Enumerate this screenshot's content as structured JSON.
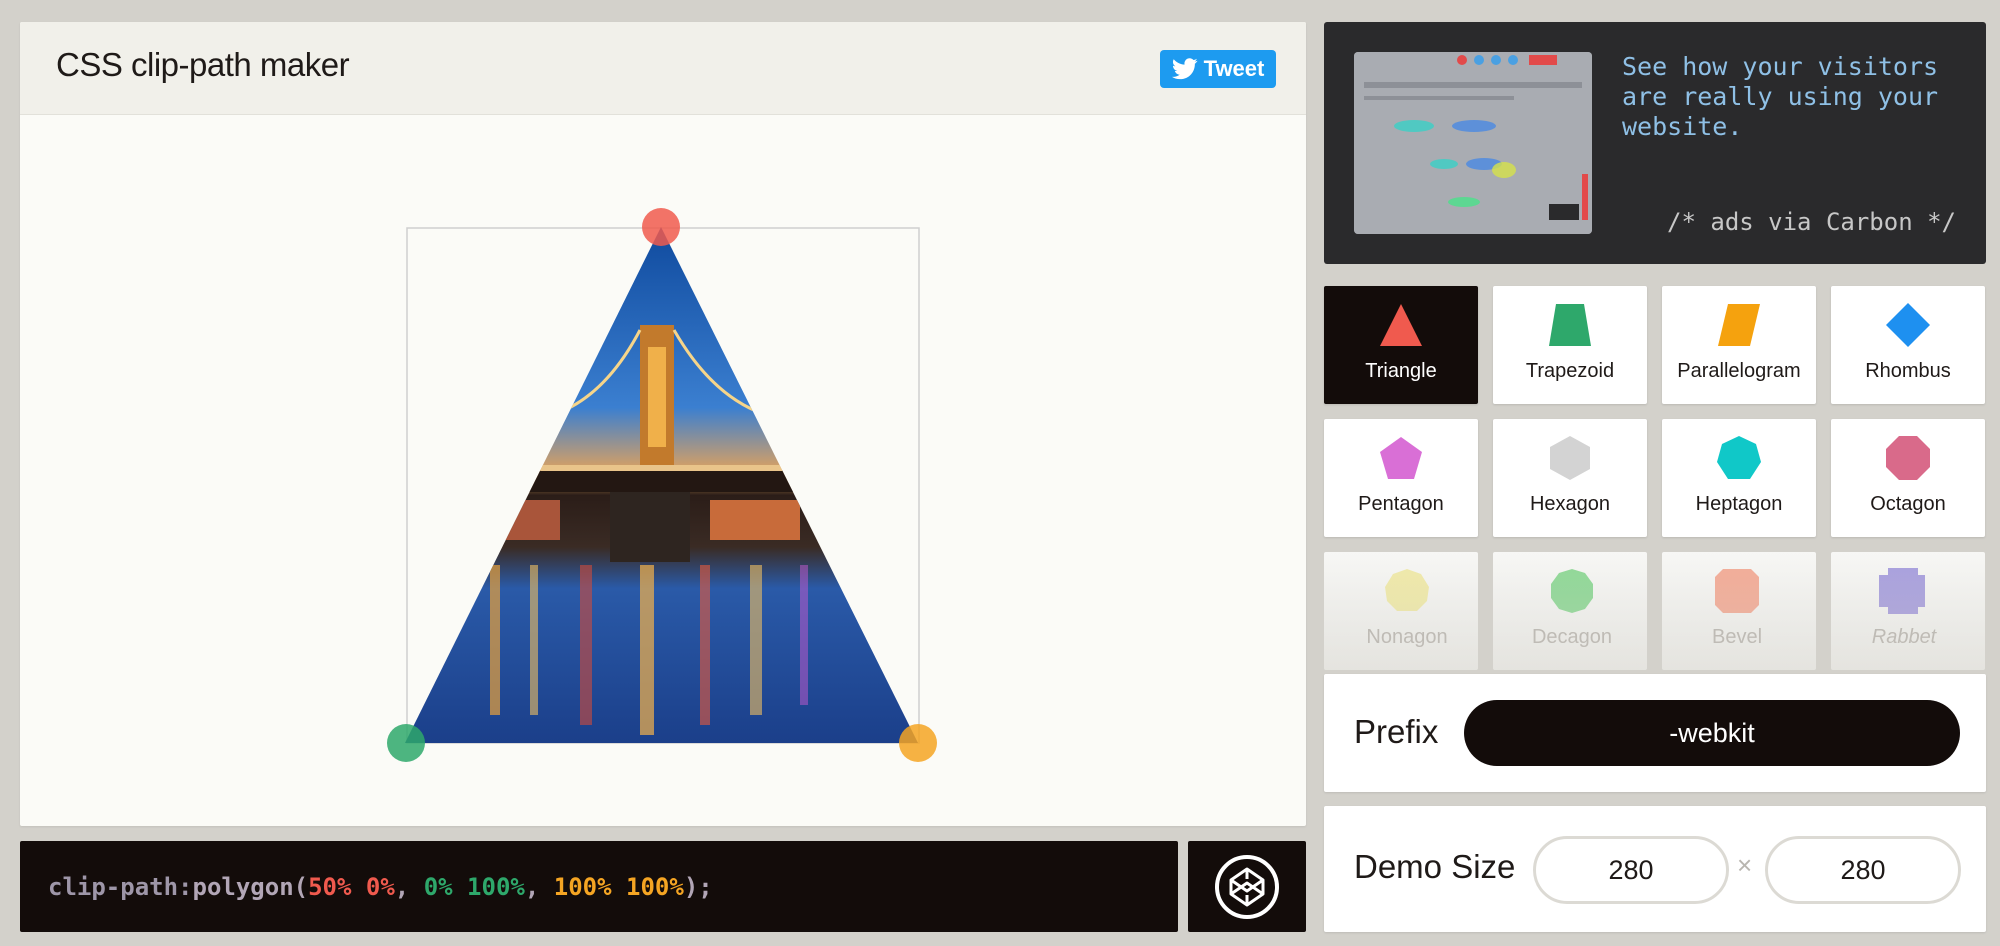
{
  "header": {
    "title": "CSS clip-path maker",
    "tweet_label": "Tweet"
  },
  "code": {
    "property": "clip-path:",
    "fn_open": "polygon(",
    "p1": "50% 0%",
    "p2": "0% 100%",
    "p3": "100% 100%",
    "fn_close": ");",
    "sep": ", "
  },
  "ad": {
    "text": "See how your visitors are really using your website.",
    "via": "/* ads via Carbon */"
  },
  "shapes": [
    {
      "label": "Triangle",
      "color": "#f05a4e",
      "active": true
    },
    {
      "label": "Trapezoid",
      "color": "#2ea86b"
    },
    {
      "label": "Parallelogram",
      "color": "#f5a20e"
    },
    {
      "label": "Rhombus",
      "color": "#1e90f0"
    },
    {
      "label": "Pentagon",
      "color": "#d96fd6"
    },
    {
      "label": "Hexagon",
      "color": "#d3d3d3"
    },
    {
      "label": "Heptagon",
      "color": "#10c8c8"
    },
    {
      "label": "Octagon",
      "color": "#d96a8a"
    },
    {
      "label": "Nonagon",
      "color": "#ece16d"
    },
    {
      "label": "Decagon",
      "color": "#3cc14b"
    },
    {
      "label": "Bevel",
      "color": "#f2704c"
    },
    {
      "label": "Rabbet",
      "color": "#6a5acd"
    }
  ],
  "prefix": {
    "label": "Prefix",
    "value": "-webkit"
  },
  "demo_size": {
    "label": "Demo Size",
    "width": "280",
    "height": "280",
    "separator": "×"
  },
  "colors": {
    "point_top": "#f05a4e",
    "point_left": "#2ea86b",
    "point_right": "#f5a523"
  }
}
